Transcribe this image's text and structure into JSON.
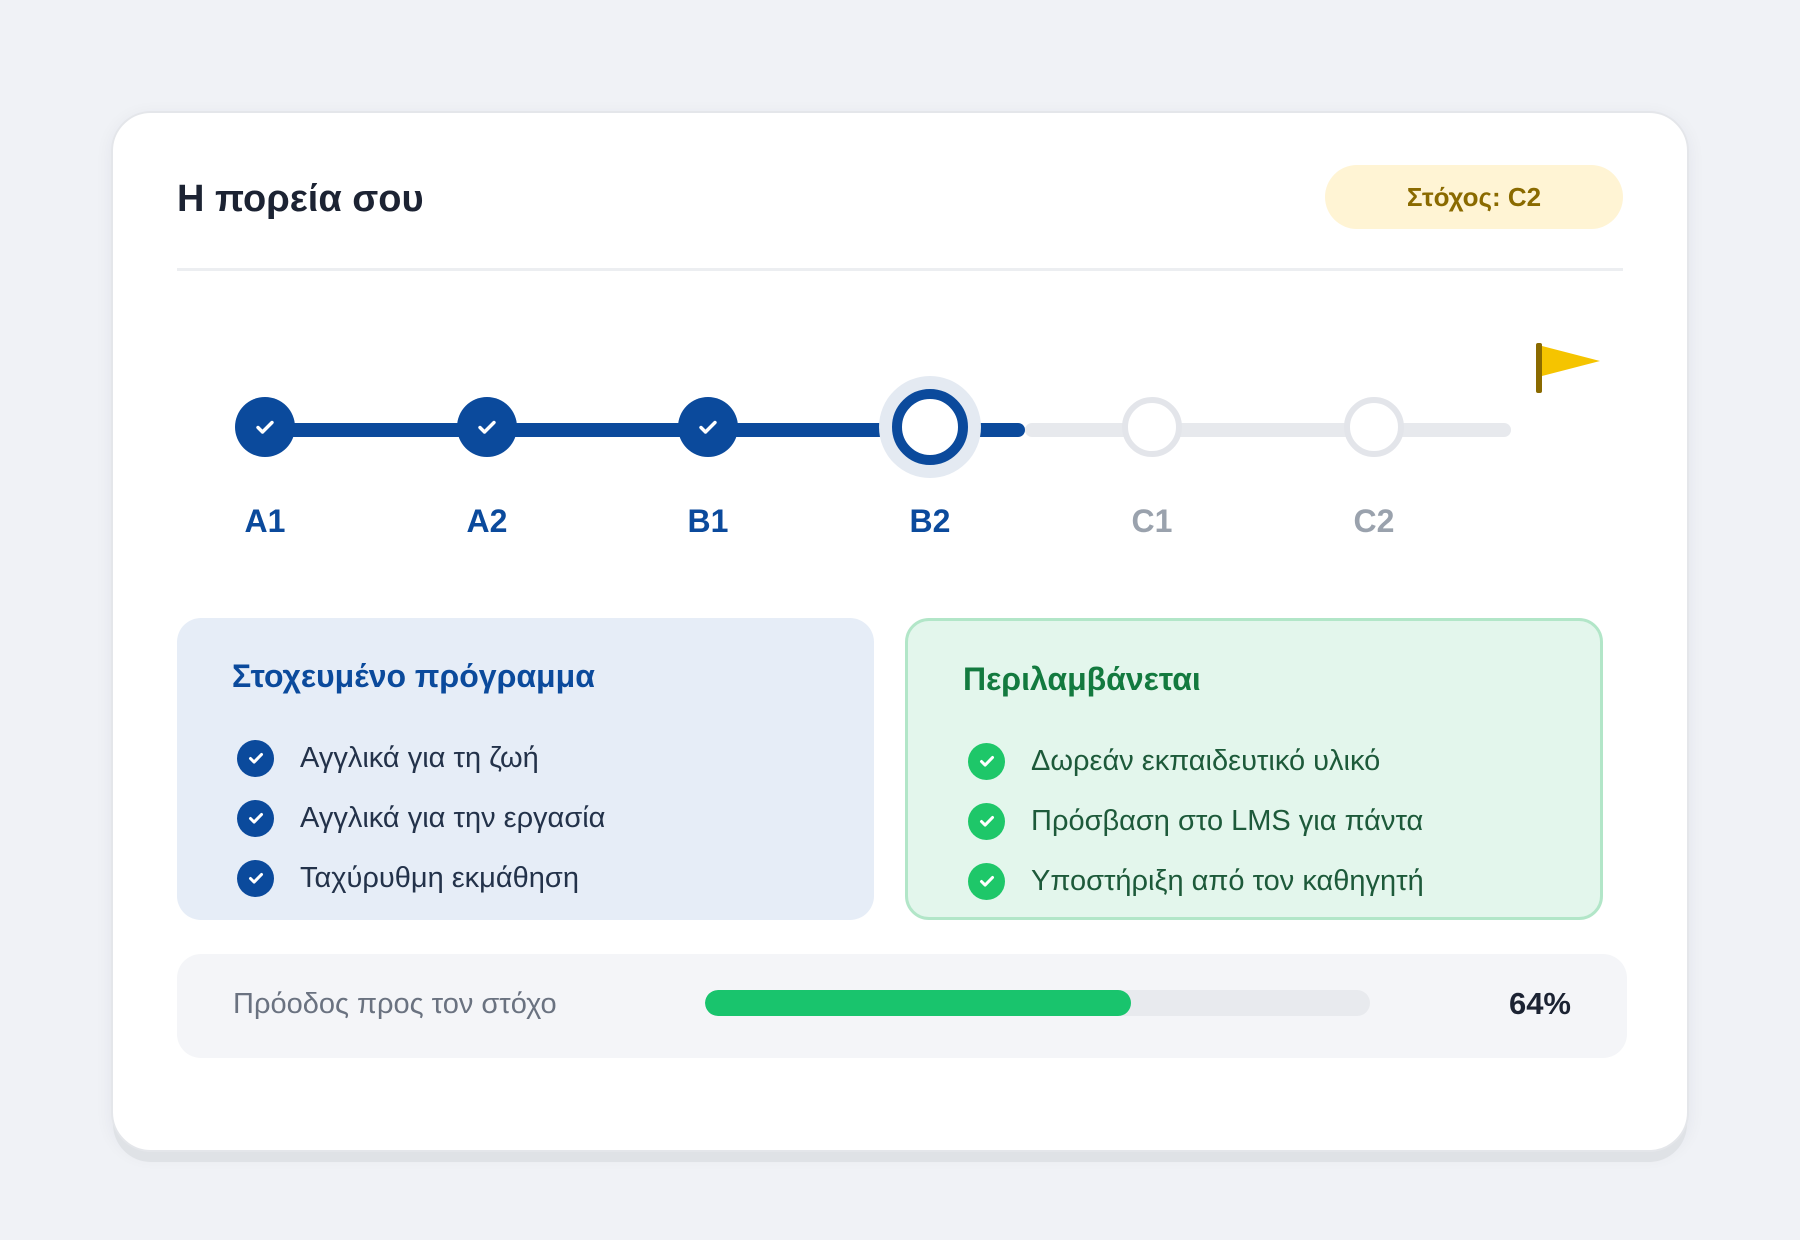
{
  "header": {
    "title": "Η πορεία σου",
    "goal_badge": "Στόχος: C2"
  },
  "stepper": {
    "steps": [
      {
        "label": "A1",
        "state": "completed"
      },
      {
        "label": "A2",
        "state": "completed"
      },
      {
        "label": "B1",
        "state": "completed"
      },
      {
        "label": "B2",
        "state": "current"
      },
      {
        "label": "C1",
        "state": "upcoming"
      },
      {
        "label": "C2",
        "state": "goal"
      }
    ],
    "goal_marker_icon": "flag-icon"
  },
  "targeted_program": {
    "title": "Στοχευμένο πρόγραμμα",
    "items": [
      "Αγγλικά για τη ζωή",
      "Αγγλικά για την εργασία",
      "Ταχύρυθμη εκμάθηση"
    ]
  },
  "included": {
    "title": "Περιλαμβάνεται",
    "items": [
      "Δωρεάν εκπαιδευτικό υλικό",
      "Πρόσβαση στο LMS για πάντα",
      "Υποστήριξη από τον καθηγητή"
    ]
  },
  "progress": {
    "label": "Πρόοδος προς τον στόχο",
    "value_text": "64%",
    "fraction": 0.64
  },
  "colors": {
    "primary": "#0b4a9c",
    "success": "#1ec769",
    "goal_accent": "#f5c400",
    "badge_bg": "#fff4d4",
    "badge_text": "#8a6a00"
  }
}
